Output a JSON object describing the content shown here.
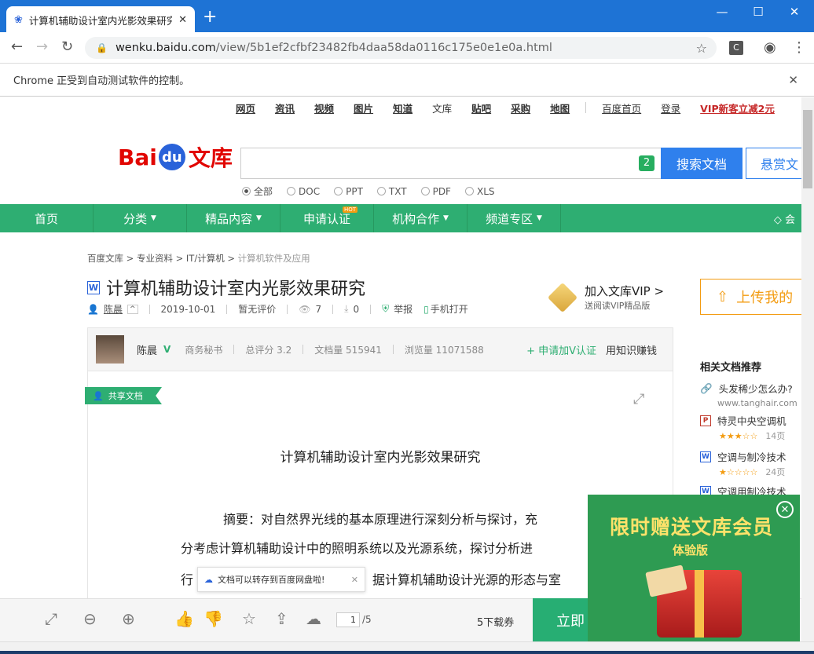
{
  "browser": {
    "tab_title": "计算机辅助设计室内光影效果研究",
    "new_tab_icon": "+",
    "url_domain": "wenku.baidu.com",
    "url_path": "/view/5b1ef2cfbf23482fb4daa58da0116c175e0e1e0a.html",
    "infobar_text": "Chrome 正受到自动测试软件的控制。",
    "ext_label": "C"
  },
  "topnav": {
    "items": [
      "网页",
      "资讯",
      "视频",
      "图片",
      "知道",
      "文库",
      "贴吧",
      "采购",
      "地图"
    ],
    "home": "百度首页",
    "login": "登录",
    "vip_promo": "VIP新客立减2元"
  },
  "logo": {
    "bai": "Bai",
    "du": "du",
    "wenku": "文库"
  },
  "search": {
    "badge": "2",
    "button": "搜索文档",
    "ask": "悬赏文",
    "filters": [
      "全部",
      "DOC",
      "PPT",
      "TXT",
      "PDF",
      "XLS"
    ]
  },
  "green_nav": {
    "items": [
      "首页",
      "分类",
      "精品内容",
      "申请认证",
      "机构合作",
      "频道专区"
    ],
    "hot": "HOT",
    "member": "会"
  },
  "breadcrumb": {
    "a": "百度文库",
    "b": "专业资料",
    "c": "IT/计算机",
    "d": "计算机软件及应用"
  },
  "doc": {
    "title": "计算机辅助设计室内光影效果研究",
    "author": "陈晨",
    "date": "2019-10-01",
    "rating": "暂无评价",
    "views": "7",
    "downloads": "0",
    "report": "举报",
    "mobile": "手机打开"
  },
  "vip": {
    "title": "加入文库VIP >",
    "subtitle": "送阅读VIP精品版"
  },
  "upload": {
    "label": "上传我的"
  },
  "author_bar": {
    "name": "陈晨",
    "role": "商务秘书",
    "score": "总评分 3.2",
    "docs": "文档量 515941",
    "reads": "浏览量 11071588",
    "apply": "+ 申请加V认证",
    "earn": "用知识赚钱"
  },
  "shared_label": "共享文档",
  "content": {
    "title": "计算机辅助设计室内光影效果研究",
    "line1": "摘要：对自然界光线的基本原理进行深刻分析与探讨，充",
    "line2": "分考虑计算机辅助设计中的照明系统以及光源系统，探讨分析进",
    "line3a": "行",
    "line3b": "据计算机辅助设计光源的形态与室"
  },
  "toast": {
    "text": "文档可以转存到百度网盘啦!"
  },
  "sidebar": {
    "title": "相关文档推荐",
    "items": [
      {
        "title": "头发稀少怎么办?",
        "sub": "www.tanghair.com"
      },
      {
        "title": "特灵中央空调机",
        "pages": "14页",
        "stars": "★★★☆☆"
      },
      {
        "title": "空调与制冷技术",
        "pages": "24页",
        "stars": "★☆☆☆☆"
      },
      {
        "title": "空调用制冷技术"
      }
    ]
  },
  "bottom": {
    "page_current": "1",
    "page_total": "/5",
    "downloads": "5下载券",
    "download_btn": "立即"
  },
  "promo": {
    "line1": "限时赠送文库会员",
    "line2": "体验版"
  },
  "colors": {
    "chrome_blue": "#1e73d5",
    "baidu_green": "#2eae72",
    "baidu_red": "#e10602",
    "search_blue": "#2f80ed"
  }
}
